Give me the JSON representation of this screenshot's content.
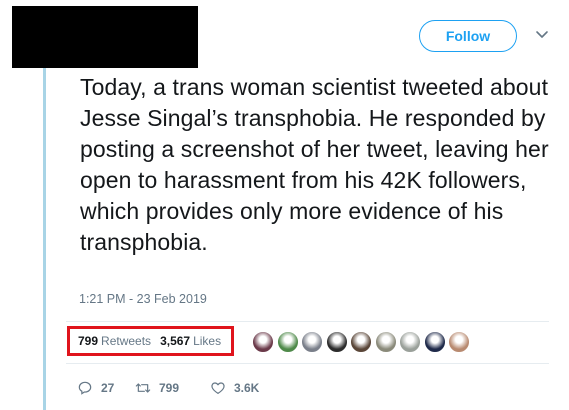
{
  "header": {
    "follow_label": "Follow",
    "accent_color": "#1da1f2",
    "menu_icon": "chevron-down-icon"
  },
  "tweet": {
    "text": "Today, a trans woman scientist tweeted about Jesse Singal’s transphobia. He responded by posting a screenshot of her tweet, leaving her open to harassment from his 42K followers, which provides only more evidence of his transphobia.",
    "timestamp": "1:21 PM - 23 Feb 2019"
  },
  "stats": {
    "retweets_count": "799",
    "retweets_label": "Retweets",
    "likes_count": "3,567",
    "likes_label": "Likes",
    "highlight_color": "#e0141c"
  },
  "liked_by_avatars": [
    {
      "color": "#6b3a4a"
    },
    {
      "color": "#4f8a4a"
    },
    {
      "color": "#7a7f8a"
    },
    {
      "color": "#2c2c2c"
    },
    {
      "color": "#5a4638"
    },
    {
      "color": "#8a8a7a"
    },
    {
      "color": "#9aa09a"
    },
    {
      "color": "#1f2a4a"
    },
    {
      "color": "#b88a70"
    }
  ],
  "actions": {
    "reply_count": "27",
    "retweet_count": "799",
    "like_count": "3.6K"
  }
}
